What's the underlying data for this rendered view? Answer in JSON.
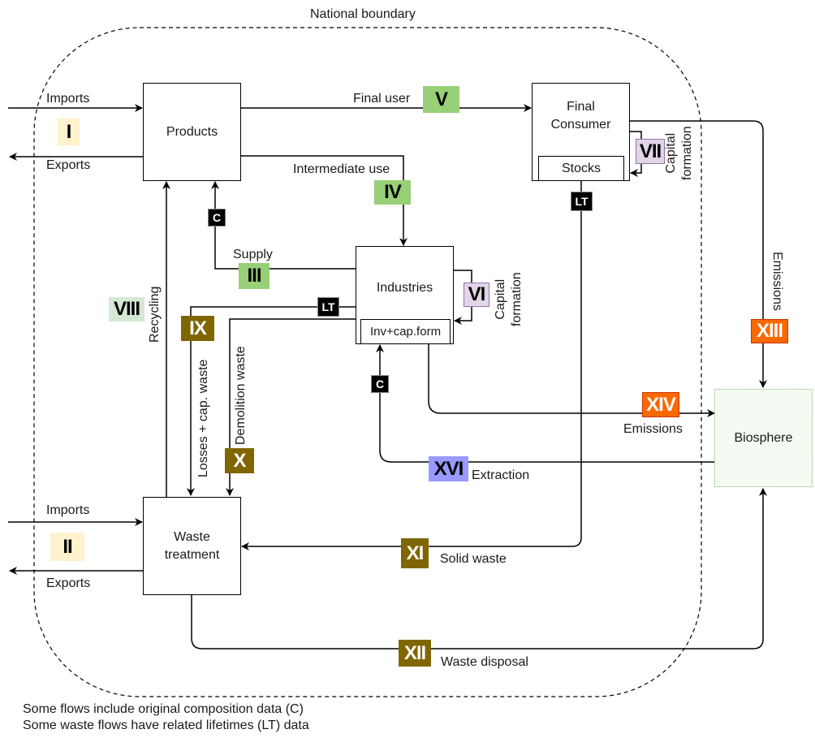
{
  "boundary": {
    "label": "National boundary"
  },
  "nodes": {
    "products": "Products",
    "final_consumer": "Final\nConsumer",
    "stocks": "Stocks",
    "industries": "Industries",
    "inv_cap": "Inv+cap.form",
    "waste_treatment": "Waste\ntreatment",
    "biosphere": "Biosphere"
  },
  "flow_labels": {
    "imports_top": "Imports",
    "exports_top": "Exports",
    "final_user": "Final user",
    "intermediate_use": "Intermediate use",
    "supply": "Supply",
    "capital_formation_vi": "Capital\nformation",
    "capital_formation_vii": "Capital\nformation",
    "recycling": "Recycling",
    "losses_cap_waste": "Losses + cap. waste",
    "demolition_waste": "Demolition waste",
    "emissions_xiii": "Emissions",
    "emissions_xiv": "Emissions",
    "extraction": "Extraction",
    "imports_bottom": "Imports",
    "exports_bottom": "Exports",
    "solid_waste": "Solid waste",
    "waste_disposal": "Waste disposal"
  },
  "badges": {
    "I": {
      "text": "I",
      "color": "#fff2cc",
      "fg": "#000000"
    },
    "II": {
      "text": "II",
      "color": "#fff2cc",
      "fg": "#000000"
    },
    "III": {
      "text": "III",
      "color": "#97d077",
      "fg": "#000000"
    },
    "IV": {
      "text": "IV",
      "color": "#97d077",
      "fg": "#000000"
    },
    "V": {
      "text": "V",
      "color": "#97d077",
      "fg": "#000000"
    },
    "VI": {
      "text": "VI",
      "color": "#e1d5e7",
      "fg": "#000000"
    },
    "VII": {
      "text": "VII",
      "color": "#e1d5e7",
      "fg": "#000000"
    },
    "VIII": {
      "text": "VIII",
      "color": "#d5e8d4",
      "fg": "#000000"
    },
    "IX": {
      "text": "IX",
      "color": "#806600",
      "fg": "#ffffff"
    },
    "X": {
      "text": "X",
      "color": "#806600",
      "fg": "#ffffff"
    },
    "XI": {
      "text": "XI",
      "color": "#806600",
      "fg": "#ffffff"
    },
    "XII": {
      "text": "XII",
      "color": "#806600",
      "fg": "#ffffff"
    },
    "XIII": {
      "text": "XIII",
      "color": "#fa6800",
      "fg": "#ffffff"
    },
    "XIV": {
      "text": "XIV",
      "color": "#fa6800",
      "fg": "#ffffff"
    },
    "XVI": {
      "text": "XVI",
      "color": "#9999ff",
      "fg": "#000000"
    }
  },
  "tags": {
    "c": "C",
    "lt": "LT"
  },
  "notes": [
    "Some flows include original composition data (C)",
    "Some waste flows have related lifetimes (LT) data"
  ]
}
